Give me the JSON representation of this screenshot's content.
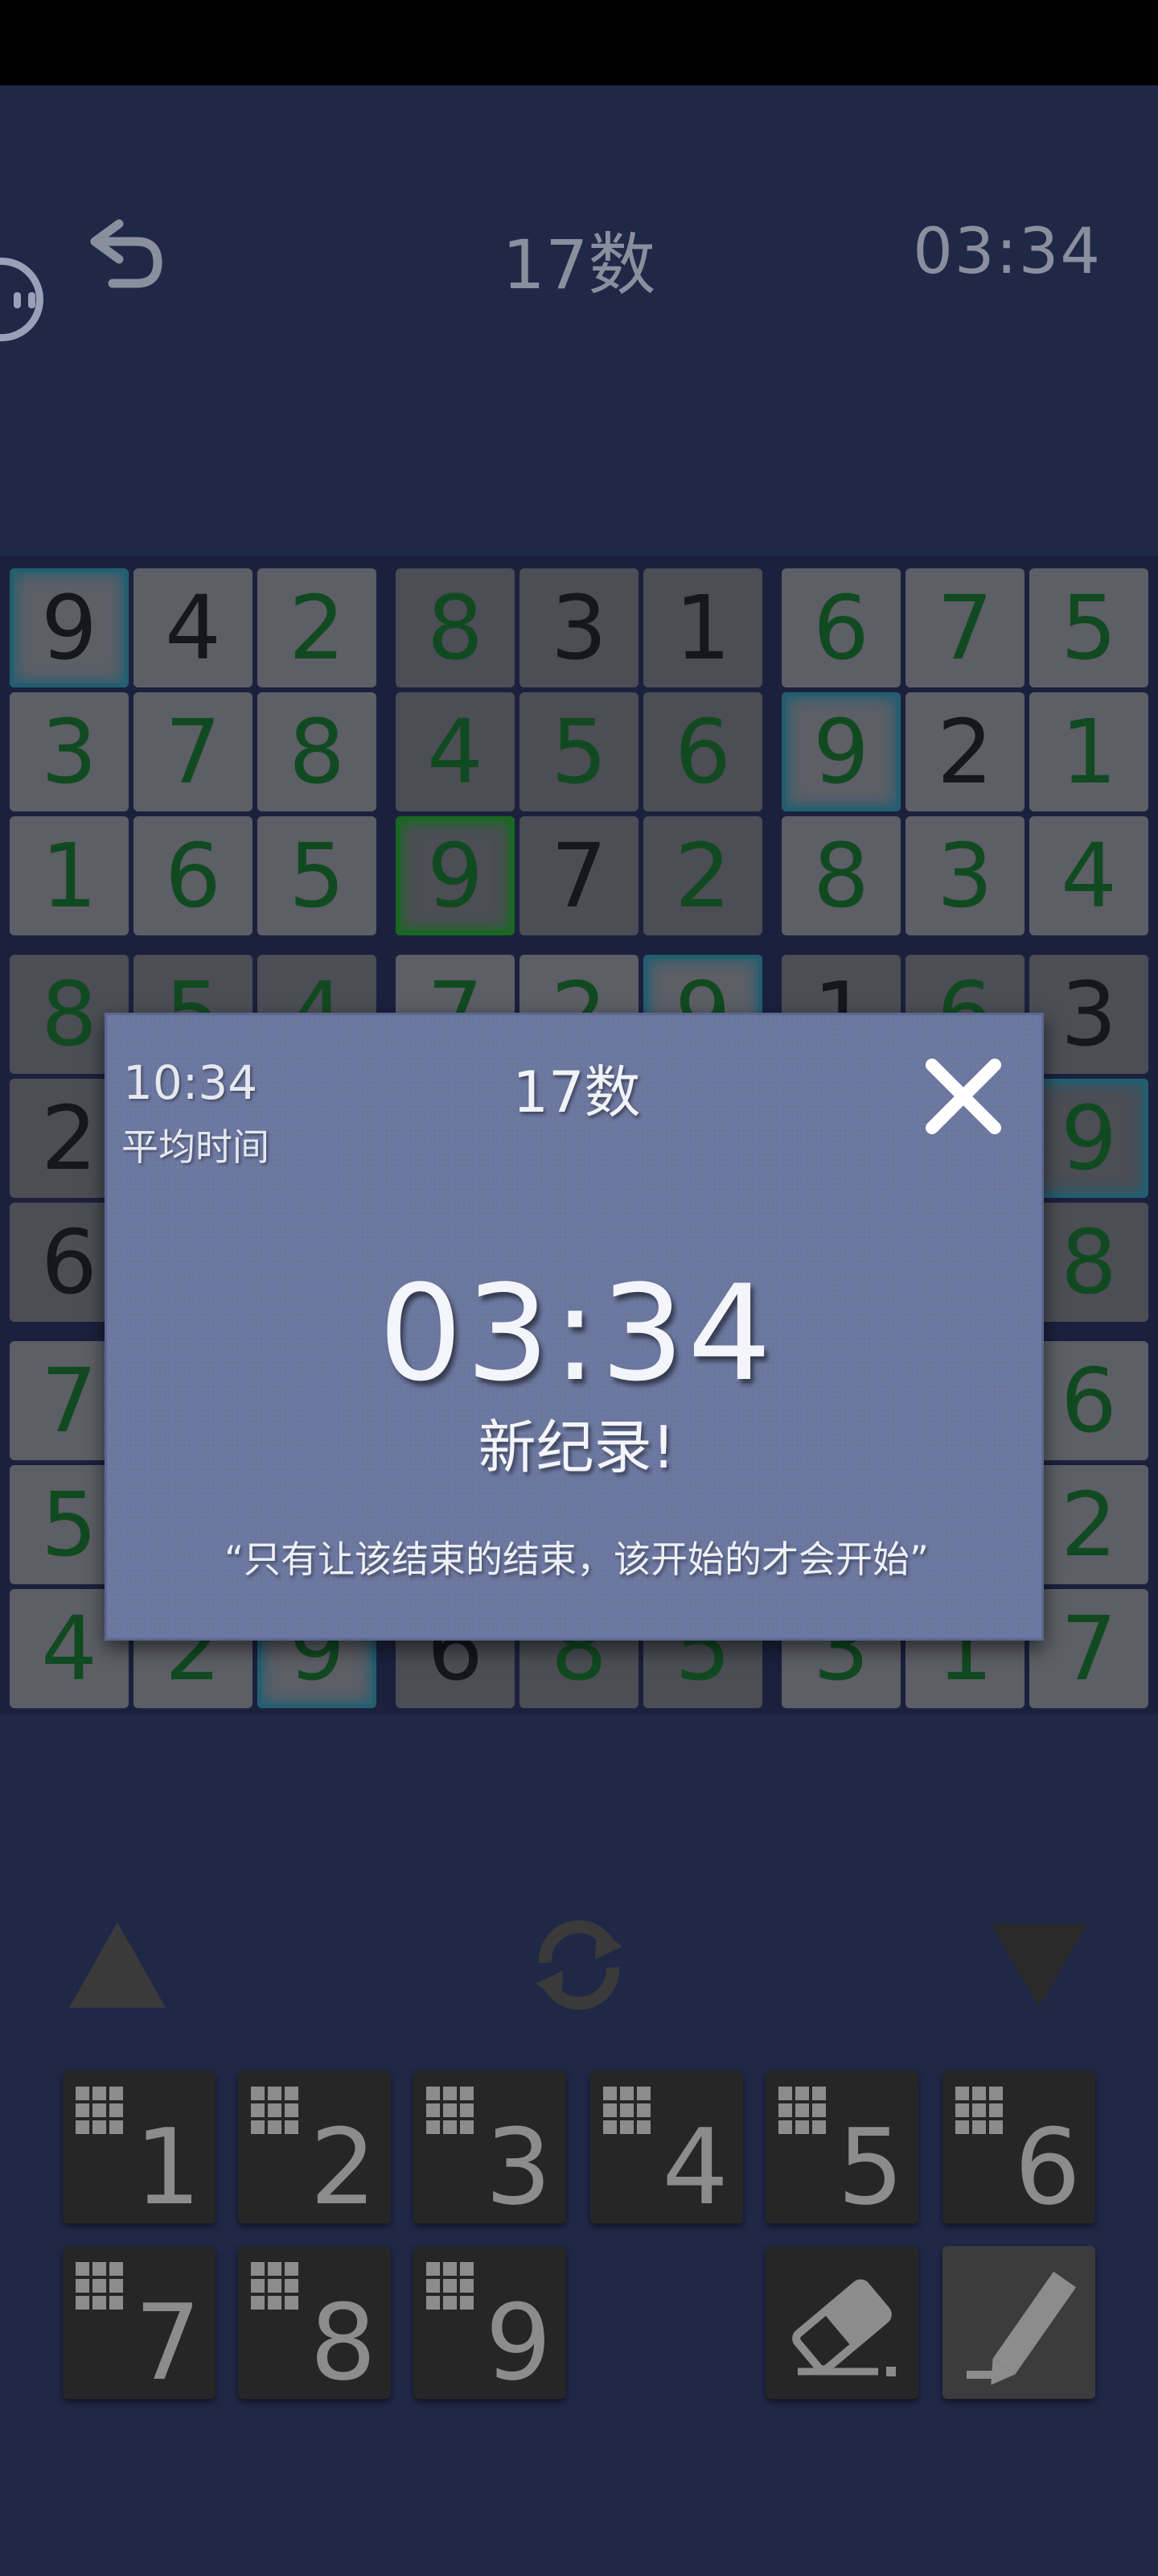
{
  "header": {
    "title": "17数",
    "timer": "03:34"
  },
  "board": {
    "rows": [
      [
        "9",
        "4",
        "2",
        "8",
        "3",
        "1",
        "6",
        "7",
        "5"
      ],
      [
        "3",
        "7",
        "8",
        "4",
        "5",
        "6",
        "9",
        "2",
        "1"
      ],
      [
        "1",
        "6",
        "5",
        "9",
        "7",
        "2",
        "8",
        "3",
        "4"
      ],
      [
        "8",
        "5",
        "4",
        "7",
        "2",
        "9",
        "1",
        "6",
        "3"
      ],
      [
        "2",
        "",
        "",
        "",
        "",
        "",
        "",
        "",
        "9"
      ],
      [
        "6",
        "",
        "",
        "",
        "",
        "",
        "",
        "",
        "8"
      ],
      [
        "7",
        "",
        "",
        "",
        "",
        "",
        "",
        "",
        "6"
      ],
      [
        "5",
        "",
        "",
        "",
        "",
        "",
        "",
        "",
        "2"
      ],
      [
        "4",
        "2",
        "9",
        "6",
        "8",
        "5",
        "3",
        "1",
        "7"
      ]
    ]
  },
  "dialog": {
    "average_time": "10:34",
    "average_label": "平均时间",
    "title": "17数",
    "time": "03:34",
    "record": "新纪录!",
    "quote": "“只有让该结束的结束，该开始的才会开始”"
  },
  "keypad": {
    "keys": [
      "1",
      "2",
      "3",
      "4",
      "5",
      "6",
      "7",
      "8",
      "9"
    ]
  },
  "colors": {
    "background": "#202848",
    "dialog": "#6b779f",
    "given_digit": "#161616",
    "entered_digit": "#0f6a1a",
    "highlight_same": "#2a8a9a",
    "highlight_selected": "#1c9a1c"
  }
}
